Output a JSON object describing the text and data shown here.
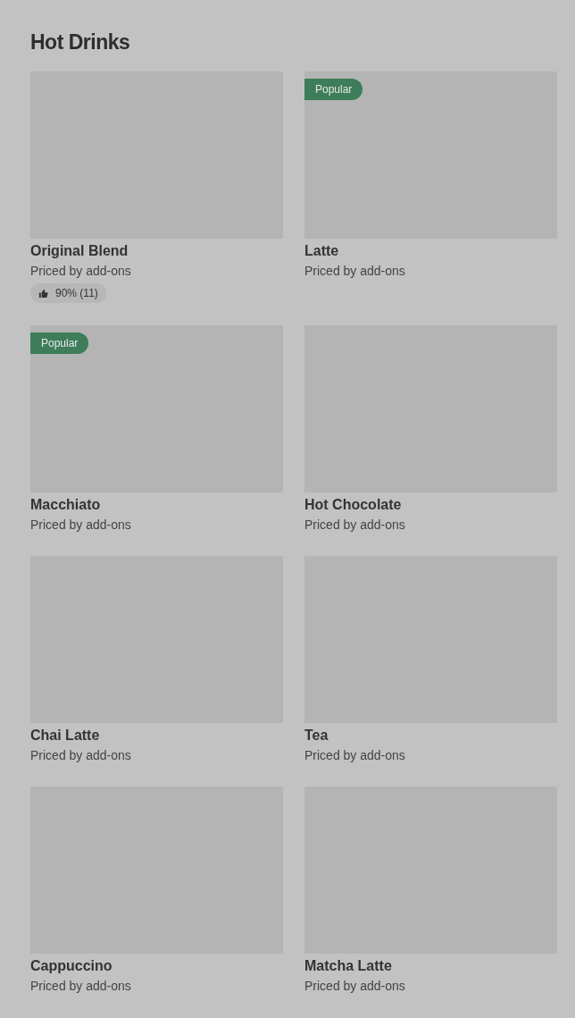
{
  "section": {
    "title": "Hot Drinks"
  },
  "rows": [
    {
      "items": [
        {
          "kind": "placeholder",
          "name": "Original Blend",
          "price": "Priced by add-ons",
          "rating": "90% (11)"
        },
        {
          "kind": "placeholder",
          "name": "Latte",
          "price": "Priced by add-ons",
          "badge": "Popular"
        }
      ]
    },
    {
      "items": [
        {
          "kind": "placeholder",
          "name": "Macchiato",
          "price": "Priced by add-ons",
          "badge": "Popular"
        },
        {
          "kind": "placeholder",
          "name": "Hot Chocolate",
          "price": "Priced by add-ons"
        }
      ]
    },
    {
      "items": [
        {
          "kind": "placeholder",
          "name": "Chai Latte",
          "price": "Priced by add-ons"
        },
        {
          "kind": "placeholder",
          "name": "Tea",
          "price": "Priced by add-ons"
        }
      ]
    },
    {
      "items": [
        {
          "kind": "placeholder",
          "name": "Cappuccino",
          "price": "Priced by add-ons"
        },
        {
          "kind": "placeholder",
          "name": "Matcha Latte",
          "price": "Priced by add-ons"
        }
      ]
    }
  ]
}
